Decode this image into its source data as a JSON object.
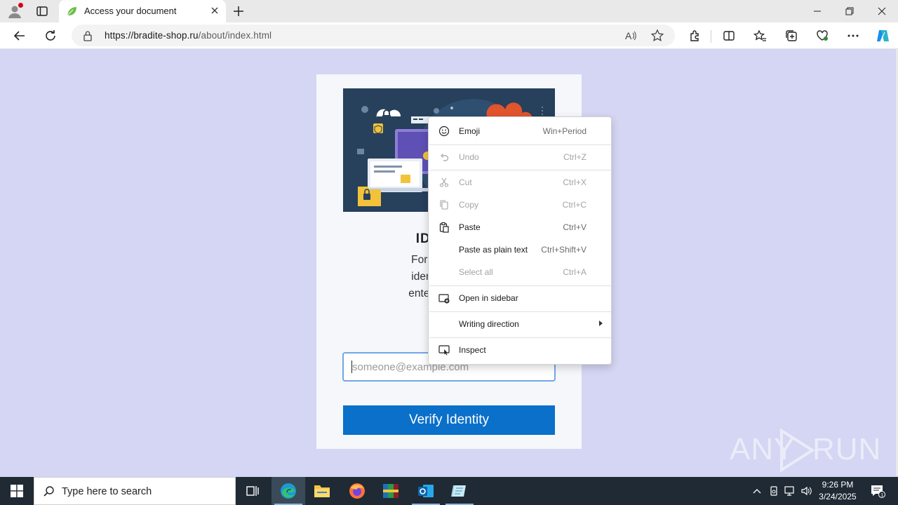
{
  "browser": {
    "tab_title": "Access your document",
    "url_host": "https://bradite-shop.ru",
    "url_path": "/about/index.html"
  },
  "page": {
    "heading": "IDENTITY",
    "paragraph_lines": [
      "For your securit",
      "identity: To gain",
      "enter the email a"
    ],
    "email_placeholder": "someone@example.com",
    "verify_label": "Verify Identity"
  },
  "context_menu": {
    "items": [
      {
        "label": "Emoji",
        "shortcut": "Win+Period",
        "icon": "emoji-icon",
        "enabled": true
      },
      {
        "label": "Undo",
        "shortcut": "Ctrl+Z",
        "icon": "undo-icon",
        "enabled": false
      },
      {
        "label": "Cut",
        "shortcut": "Ctrl+X",
        "icon": "cut-icon",
        "enabled": false
      },
      {
        "label": "Copy",
        "shortcut": "Ctrl+C",
        "icon": "copy-icon",
        "enabled": false
      },
      {
        "label": "Paste",
        "shortcut": "Ctrl+V",
        "icon": "paste-icon",
        "enabled": true
      },
      {
        "label": "Paste as plain text",
        "shortcut": "Ctrl+Shift+V",
        "icon": "",
        "enabled": true
      },
      {
        "label": "Select all",
        "shortcut": "Ctrl+A",
        "icon": "",
        "enabled": false
      },
      {
        "label": "Open in sidebar",
        "shortcut": "",
        "icon": "sidebar-icon",
        "enabled": true
      },
      {
        "label": "Writing direction",
        "shortcut": "",
        "icon": "",
        "enabled": true,
        "submenu": true
      },
      {
        "label": "Inspect",
        "shortcut": "",
        "icon": "inspect-icon",
        "enabled": true
      }
    ]
  },
  "taskbar": {
    "search_placeholder": "Type here to search",
    "time": "9:26 PM",
    "date": "3/24/2025",
    "notification_count": "1"
  },
  "watermark": {
    "text": "ANY",
    "text2": "RUN"
  },
  "colors": {
    "page_bg": "#d4d6f3",
    "button": "#0a70c9",
    "taskbar": "#1f2a34"
  }
}
